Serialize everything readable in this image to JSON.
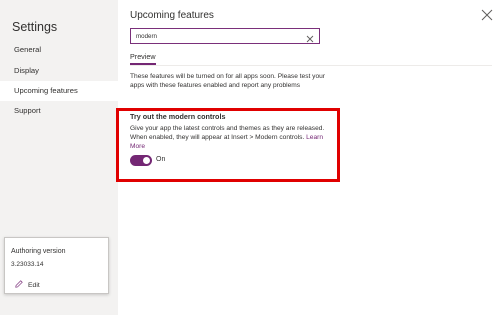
{
  "sidebar": {
    "title": "Settings",
    "items": [
      {
        "label": "General"
      },
      {
        "label": "Display"
      },
      {
        "label": "Upcoming features"
      },
      {
        "label": "Support"
      }
    ]
  },
  "authoring": {
    "title": "Authoring version",
    "version": "3.23033.14",
    "edit_label": "Edit"
  },
  "main": {
    "title": "Upcoming features",
    "search_value": "modern",
    "tab_label": "Preview",
    "description": "These features will be turned on for all apps soon. Please test your apps with these features enabled and report any problems",
    "feature": {
      "title": "Try out the modern controls",
      "description": "Give your app the latest controls and themes as they are released. When enabled, they will appear at Insert > Modern controls.",
      "link": "Learn More",
      "toggle_label": "On",
      "toggle_on": true
    }
  },
  "colors": {
    "accent": "#742774",
    "highlight_border": "#e00000",
    "sidebar_bg": "#f3f2f1"
  }
}
